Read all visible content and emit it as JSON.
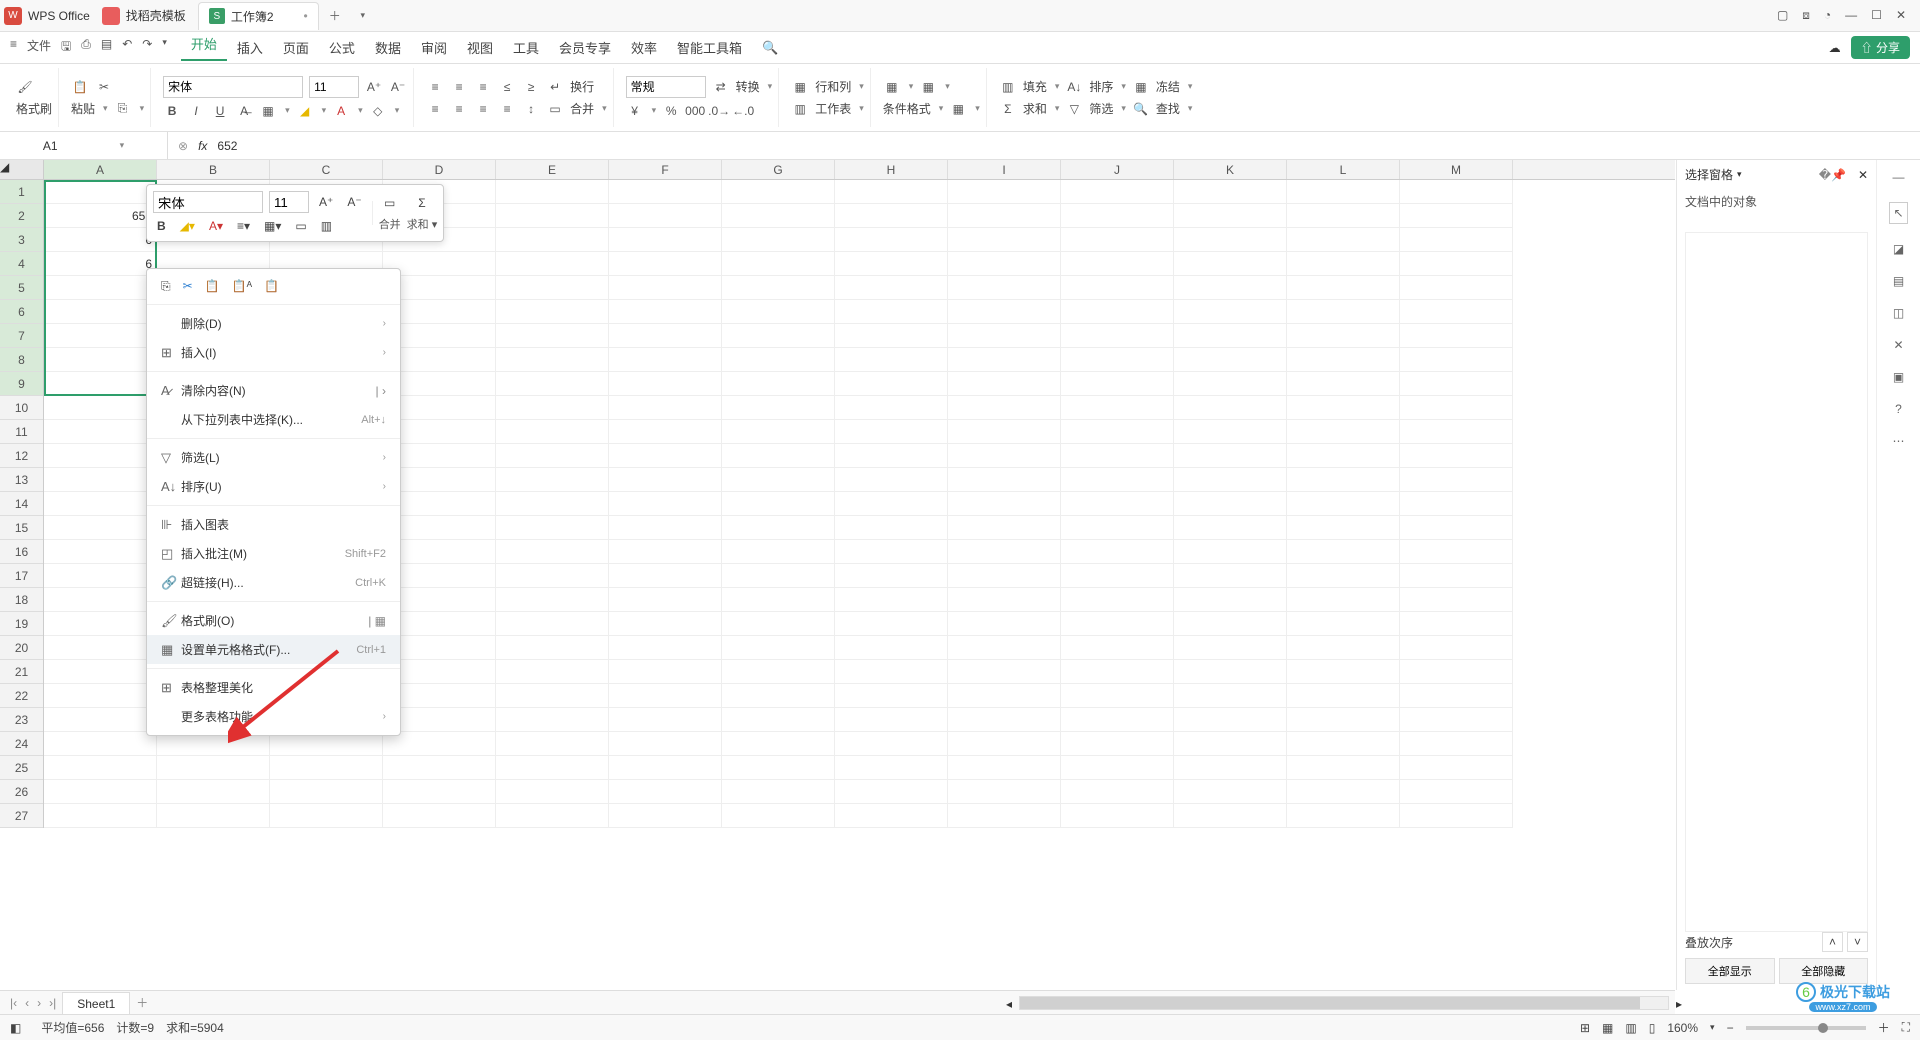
{
  "tabs": {
    "wps": "WPS Office",
    "template": "找稻壳模板",
    "workbook": "工作簿2"
  },
  "menu": {
    "file": "文件",
    "items": [
      "开始",
      "插入",
      "页面",
      "公式",
      "数据",
      "审阅",
      "视图",
      "工具",
      "会员专享",
      "效率",
      "智能工具箱"
    ],
    "share": "分享"
  },
  "ribbon": {
    "formatbrush": "格式刷",
    "paste": "粘贴",
    "font": "宋体",
    "size": "11",
    "wrap": "换行",
    "merge": "合并",
    "normal": "常规",
    "convert": "转换",
    "rowcol": "行和列",
    "worksheet": "工作表",
    "condformat": "条件格式",
    "fill": "填充",
    "sort": "排序",
    "freeze": "冻结",
    "sum": "求和",
    "filter": "筛选",
    "find": "查找"
  },
  "formulabar": {
    "name": "A1",
    "value": "652"
  },
  "columns": [
    "A",
    "B",
    "C",
    "D",
    "E",
    "F",
    "G",
    "H",
    "I",
    "J",
    "K",
    "L",
    "M"
  ],
  "cellA2": "653",
  "cellvals": [
    "6",
    "6",
    "6",
    "6",
    "6",
    "6",
    "6"
  ],
  "minitb": {
    "font": "宋体",
    "size": "11",
    "merge": "合并",
    "sum": "求和"
  },
  "ctx": {
    "delete": "删除(D)",
    "insert": "插入(I)",
    "clear": "清除内容(N)",
    "dropdown": "从下拉列表中选择(K)...",
    "dropdown_sc": "Alt+↓",
    "filter": "筛选(L)",
    "sort": "排序(U)",
    "chart": "插入图表",
    "comment": "插入批注(M)",
    "comment_sc": "Shift+F2",
    "link": "超链接(H)...",
    "link_sc": "Ctrl+K",
    "brush": "格式刷(O)",
    "format": "设置单元格格式(F)...",
    "format_sc": "Ctrl+1",
    "beautify": "表格整理美化",
    "more": "更多表格功能"
  },
  "rpanel": {
    "title": "选择窗格",
    "subtitle": "文档中的对象",
    "stack": "叠放次序",
    "showall": "全部显示",
    "hideall": "全部隐藏"
  },
  "sheet": {
    "name": "Sheet1"
  },
  "status": {
    "avg": "平均值=656",
    "count": "计数=9",
    "sum": "求和=5904",
    "zoom": "160%"
  },
  "watermark": {
    "l1": "极光下载站",
    "l2": "www.xz7.com"
  }
}
